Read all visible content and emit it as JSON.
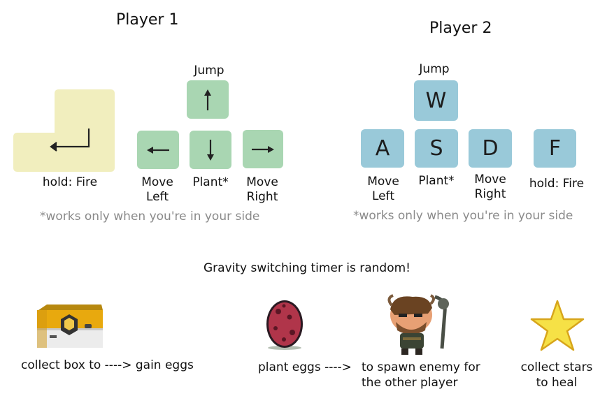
{
  "player1": {
    "title": "Player 1",
    "jump_label": "Jump",
    "fire_label": "hold: Fire",
    "left_label": "Move\nLeft",
    "plant_label": "Plant*",
    "right_label": "Move\nRight",
    "note": "*works only when you're in your side",
    "key_icons": [
      "enter-arrow-icon",
      "arrow-up-icon",
      "arrow-left-icon",
      "arrow-down-icon",
      "arrow-right-icon"
    ]
  },
  "player2": {
    "title": "Player 2",
    "jump_label": "Jump",
    "keys": {
      "jump": "W",
      "left": "A",
      "plant": "S",
      "right": "D",
      "fire": "F"
    },
    "left_label": "Move\nLeft",
    "plant_label": "Plant*",
    "right_label": "Move\nRight",
    "fire_label": "hold: Fire",
    "note": "*works only when you're in your side"
  },
  "gravity_text": "Gravity switching timer is random!",
  "bottom": {
    "box_text": "collect box to ----> gain eggs",
    "plant_text": "plant eggs ---->",
    "spawn_text": "to spawn enemy for\nthe other player",
    "stars_text": "collect stars\nto heal"
  },
  "colors": {
    "green_key": "#a9d6b2",
    "blue_key": "#99c9d9",
    "enter_key": "#f1eebe",
    "note": "#8a8a8a"
  }
}
